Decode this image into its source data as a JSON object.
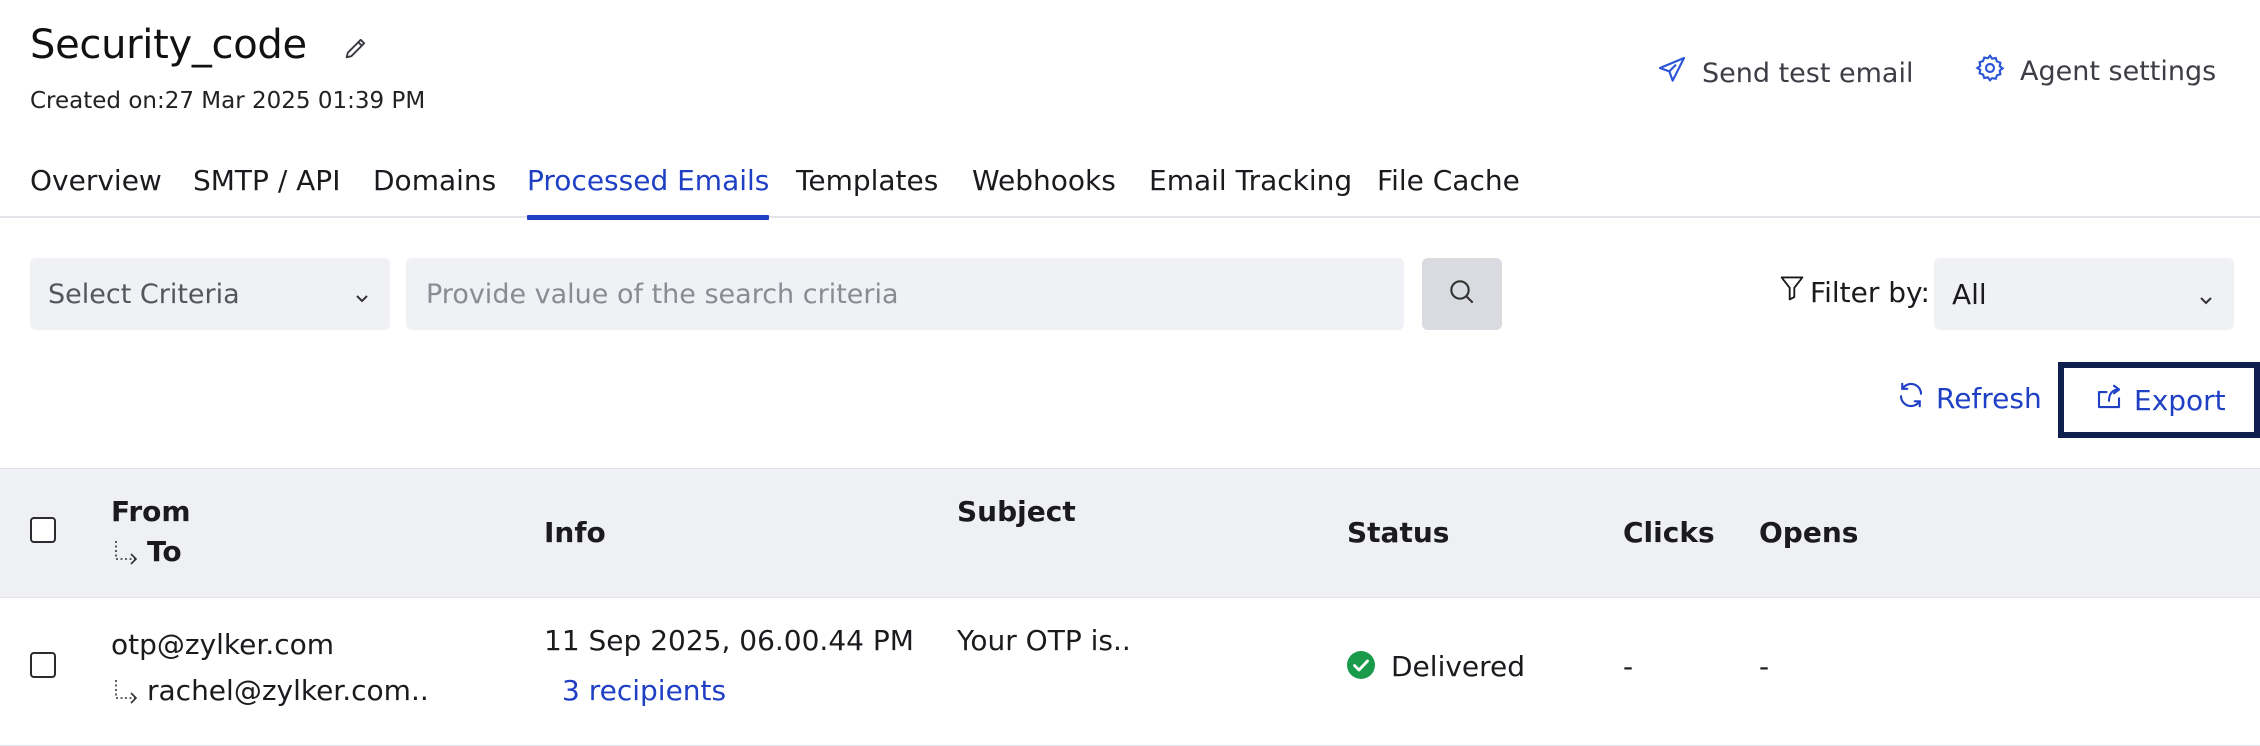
{
  "header": {
    "title": "Security_code",
    "created": "Created on:27 Mar 2025 01:39 PM",
    "send_test_email": "Send test email",
    "agent_settings": "Agent settings"
  },
  "tabs": [
    {
      "label": "Overview"
    },
    {
      "label": "SMTP / API"
    },
    {
      "label": "Domains"
    },
    {
      "label": "Processed Emails",
      "active": true
    },
    {
      "label": "Templates"
    },
    {
      "label": "Webhooks"
    },
    {
      "label": "Email Tracking"
    },
    {
      "label": "File Cache"
    }
  ],
  "search": {
    "criteria_label": "Select Criteria",
    "placeholder": "Provide value of the search criteria",
    "value": ""
  },
  "filter": {
    "label": "Filter by:",
    "value": "All"
  },
  "actions": {
    "refresh": "Refresh",
    "export": "Export"
  },
  "table": {
    "headers": {
      "from": "From",
      "to": "To",
      "info": "Info",
      "subject": "Subject",
      "status": "Status",
      "clicks": "Clicks",
      "opens": "Opens"
    },
    "rows": [
      {
        "from": "otp@zylker.com",
        "to": "rachel@zylker.com..",
        "date": "11 Sep 2025, 06.00.44 PM",
        "recipients": "3 recipients",
        "subject": "Your OTP is..",
        "status": "Delivered",
        "clicks": "-",
        "opens": "-"
      }
    ]
  },
  "colors": {
    "accent": "#1f3fc4",
    "delivered": "#1a9a4b",
    "export_focus_border": "#0f2050"
  }
}
